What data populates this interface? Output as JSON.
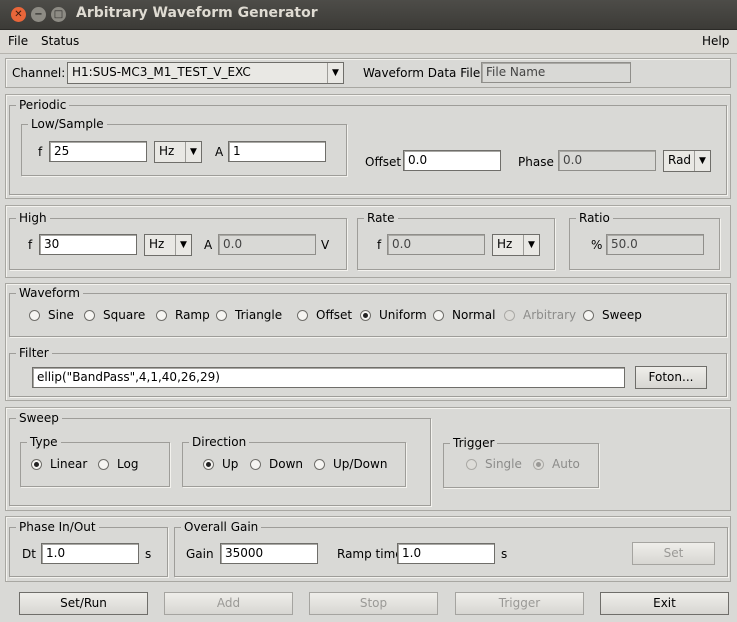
{
  "window": {
    "title": "Arbitrary Waveform Generator"
  },
  "menu": {
    "file": "File",
    "status": "Status",
    "help": "Help"
  },
  "channel": {
    "label": "Channel:",
    "value": "H1:SUS-MC3_M1_TEST_V_EXC",
    "data_file_label": "Waveform Data File:",
    "data_file_value": "File Name"
  },
  "periodic": {
    "title": "Periodic",
    "low_sample": {
      "title": "Low/Sample",
      "f_label": "f",
      "f_value": "25",
      "unit": "Hz",
      "a_label": "A",
      "a_value": "1"
    },
    "offset_label": "Offset",
    "offset_value": "0.0",
    "phase_label": "Phase",
    "phase_value": "0.0",
    "phase_unit": "Rad"
  },
  "high": {
    "title": "High",
    "f_label": "f",
    "f_value": "30",
    "unit": "Hz",
    "a_label": "A",
    "a_value": "0.0",
    "v_label": "V"
  },
  "rate": {
    "title": "Rate",
    "f_label": "f",
    "f_value": "0.0",
    "unit": "Hz"
  },
  "ratio": {
    "title": "Ratio",
    "pct_label": "%",
    "value": "50.0"
  },
  "waveform": {
    "title": "Waveform",
    "options": [
      "Sine",
      "Square",
      "Ramp",
      "Triangle",
      "Offset",
      "Uniform",
      "Normal",
      "Arbitrary",
      "Sweep"
    ],
    "selected": "Uniform"
  },
  "filter": {
    "title": "Filter",
    "value": "ellip(\"BandPass\",4,1,40,26,29)",
    "foton_label": "Foton..."
  },
  "sweep": {
    "title": "Sweep",
    "type": {
      "title": "Type",
      "linear": "Linear",
      "log": "Log",
      "selected": "Linear"
    },
    "direction": {
      "title": "Direction",
      "up": "Up",
      "down": "Down",
      "updown": "Up/Down",
      "selected": "Up"
    }
  },
  "trigger": {
    "title": "Trigger",
    "single": "Single",
    "auto": "Auto",
    "selected": "Auto"
  },
  "phase_inout": {
    "title": "Phase In/Out",
    "dt_label": "Dt",
    "dt_value": "1.0",
    "s_label": "s"
  },
  "overall_gain": {
    "title": "Overall Gain",
    "gain_label": "Gain",
    "gain_value": "35000",
    "ramp_label": "Ramp time",
    "ramp_value": "1.0",
    "s_label": "s",
    "set_label": "Set"
  },
  "actions": {
    "setrun": "Set/Run",
    "add": "Add",
    "stop": "Stop",
    "trigger": "Trigger",
    "exit": "Exit"
  }
}
